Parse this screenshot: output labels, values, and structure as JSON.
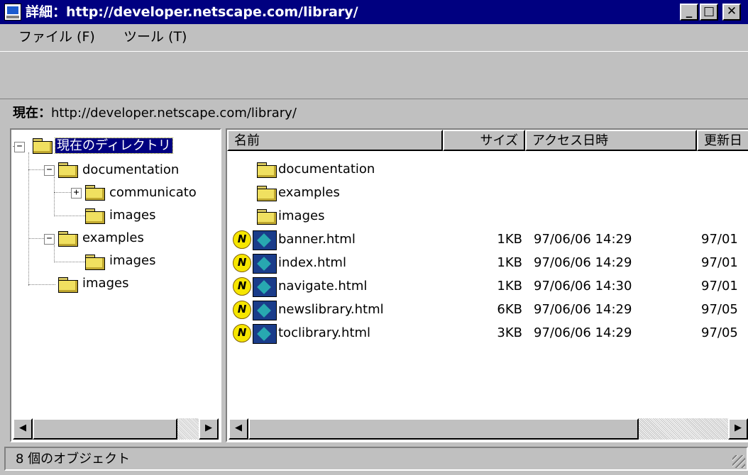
{
  "window": {
    "title": "詳細：http://developer.netscape.com/library/",
    "controls": {
      "minimize": "_",
      "maximize": "□",
      "close": "✕"
    }
  },
  "menu": {
    "items": [
      {
        "label": "ファイル (F)"
      },
      {
        "label": "ツール (T)"
      }
    ]
  },
  "address": {
    "label": "現在：",
    "url": "http://developer.netscape.com/library/"
  },
  "tree": {
    "nodes": [
      {
        "label": "現在のディレクトリ"
      },
      {
        "label": "documentation"
      },
      {
        "label": "communicato"
      },
      {
        "label": "images"
      },
      {
        "label": "examples"
      },
      {
        "label": "images"
      },
      {
        "label": "images"
      }
    ],
    "toggles": {
      "minus": "−",
      "plus": "+"
    }
  },
  "list": {
    "columns": [
      {
        "label": "名前"
      },
      {
        "label": "サイズ"
      },
      {
        "label": "アクセス日時"
      },
      {
        "label": "更新日"
      }
    ],
    "folders": [
      {
        "name": "documentation"
      },
      {
        "name": "examples"
      },
      {
        "name": "images"
      }
    ],
    "files": [
      {
        "name": "banner.html",
        "size": "1KB",
        "accessed": "97/06/06 14:29",
        "modified": "97/01"
      },
      {
        "name": "index.html",
        "size": "1KB",
        "accessed": "97/06/06 14:29",
        "modified": "97/01"
      },
      {
        "name": "navigate.html",
        "size": "1KB",
        "accessed": "97/06/06 14:30",
        "modified": "97/01"
      },
      {
        "name": "newslibrary.html",
        "size": "6KB",
        "accessed": "97/06/06 14:29",
        "modified": "97/05"
      },
      {
        "name": "toclibrary.html",
        "size": "3KB",
        "accessed": "97/06/06 14:29",
        "modified": "97/05"
      }
    ],
    "file_icon_letter": "N"
  },
  "scrollbar": {
    "left_arrow": "◀",
    "right_arrow": "▶"
  },
  "status": {
    "text": "8 個のオブジェクト"
  },
  "colors": {
    "titlebar": "#000080",
    "face": "#c0c0c0",
    "selection": "#000080",
    "folder": "#f0e060"
  }
}
